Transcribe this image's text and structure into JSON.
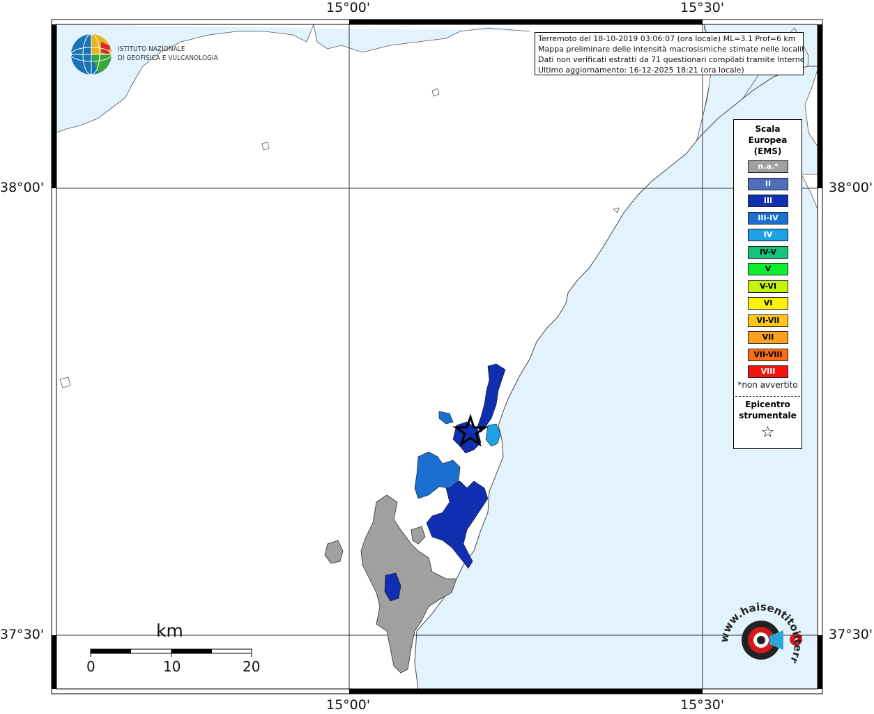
{
  "header": {
    "institute_line1": "ISTITUTO NAZIONALE",
    "institute_line2": "DI GEOFISICA E VULCANOLOGIA"
  },
  "coordinates": {
    "top": [
      "15°00'",
      "15°30'"
    ],
    "bottom": [
      "15°00'",
      "15°30'"
    ],
    "left": [
      "38°00'",
      "37°30'"
    ],
    "right": [
      "38°00'",
      "37°30'"
    ]
  },
  "info": {
    "line1": "Terremoto del 18-10-2019 03:06:07 (ora locale) ML=3.1 Prof=6 km",
    "line2": "Mappa preliminare delle intensità macrosismiche stimate nelle località",
    "line3": "Dati non verificati estratti da 71 questionari compilati tramite Internet.",
    "line4": "Ultimo aggiornamento: 16-12-2025 18:21 (ora locale)"
  },
  "legend": {
    "title_line1": "Scala",
    "title_line2": "Europea",
    "title_line3": "(EMS)",
    "items": [
      {
        "label": "n.a.*",
        "color": "#a0a0a0",
        "text_color": "#ffffff"
      },
      {
        "label": "II",
        "color": "#4f6db8",
        "text_color": "#ffffff"
      },
      {
        "label": "III",
        "color": "#0f2fb0",
        "text_color": "#ffffff"
      },
      {
        "label": "III-IV",
        "color": "#1c6fd1",
        "text_color": "#ffffff"
      },
      {
        "label": "IV",
        "color": "#1ea2e6",
        "text_color": "#ffffff"
      },
      {
        "label": "IV-V",
        "color": "#13c47a",
        "text_color": "#000000"
      },
      {
        "label": "V",
        "color": "#12ee2f",
        "text_color": "#000000"
      },
      {
        "label": "V-VI",
        "color": "#c4f20a",
        "text_color": "#000000"
      },
      {
        "label": "VI",
        "color": "#fbf207",
        "text_color": "#000000"
      },
      {
        "label": "VI-VII",
        "color": "#fdc812",
        "text_color": "#000000"
      },
      {
        "label": "VII",
        "color": "#fca11b",
        "text_color": "#000000"
      },
      {
        "label": "VII-VIII",
        "color": "#fb6d13",
        "text_color": "#000000"
      },
      {
        "label": "VIII",
        "color": "#f2140f",
        "text_color": "#ffffff"
      }
    ],
    "not_felt_note": "*non avvertito",
    "epicenter_line1": "Epicentro",
    "epicenter_line2": "strumentale",
    "epicenter_symbol": "☆"
  },
  "scale_bar": {
    "unit": "km",
    "labels": [
      "0",
      "10",
      "20"
    ]
  },
  "watermark": {
    "text": "www.haisentitoilterremoto.it"
  },
  "colors": {
    "sea": "#e3f3fd",
    "grey_area": "#a0a0a0",
    "intensity_III": "#0f2fb0",
    "intensity_III_IV": "#1c6fd1",
    "intensity_IV": "#1ea2e6"
  }
}
